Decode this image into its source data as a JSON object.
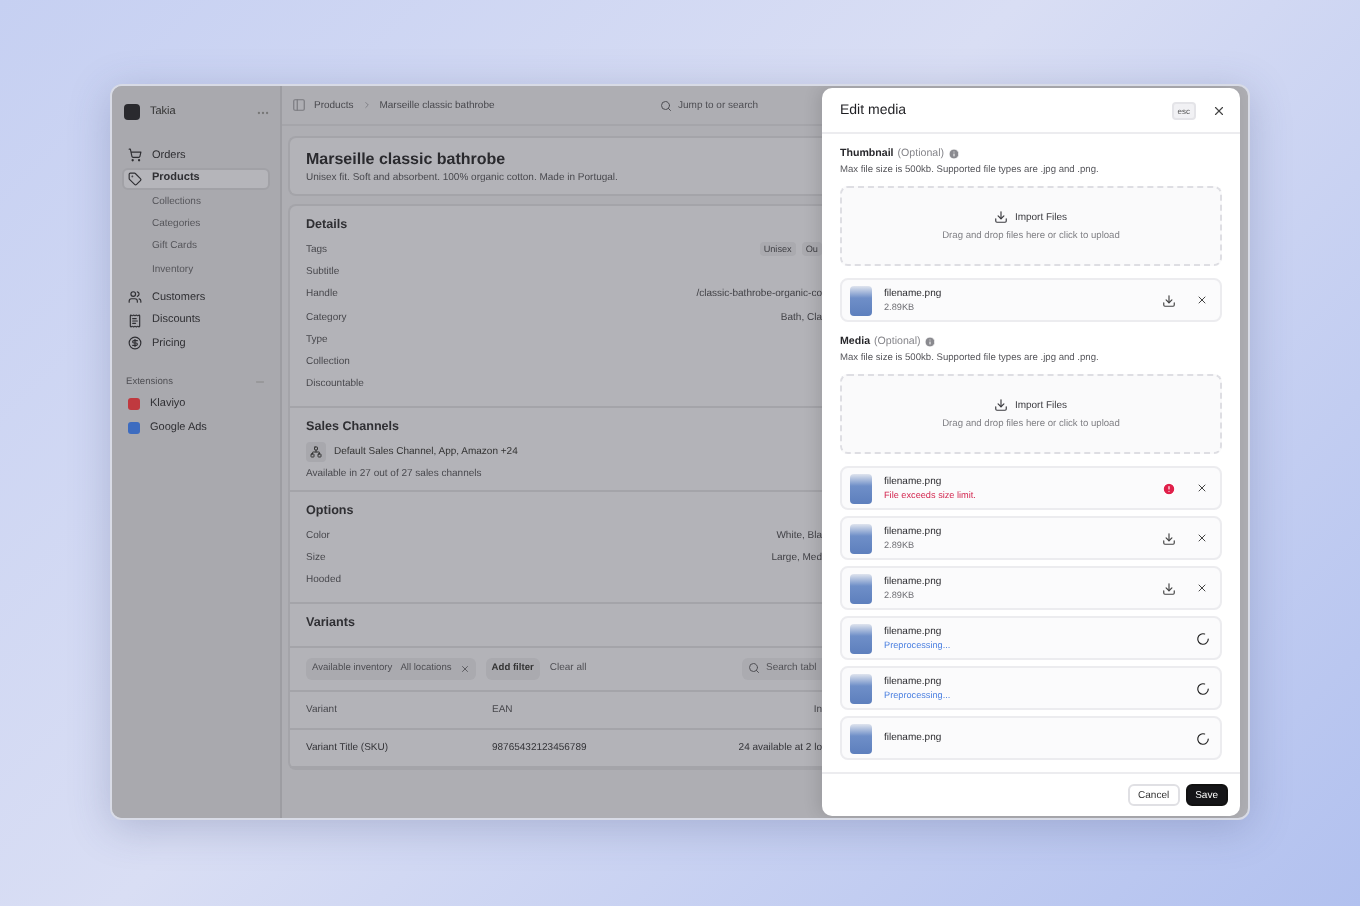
{
  "sidebar": {
    "store": "Takia",
    "items": [
      {
        "label": "Orders",
        "selected": false
      },
      {
        "label": "Products",
        "selected": true,
        "children": [
          {
            "label": "Collections"
          },
          {
            "label": "Categories"
          },
          {
            "label": "Gift Cards"
          },
          {
            "label": "Inventory"
          }
        ]
      },
      {
        "label": "Customers",
        "selected": false
      },
      {
        "label": "Discounts",
        "selected": false
      },
      {
        "label": "Pricing",
        "selected": false
      }
    ],
    "extensions_title": "Extensions",
    "extensions": [
      {
        "label": "Klaviyo",
        "color": "#c0393f"
      },
      {
        "label": "Google Ads",
        "color": "#3d6cc0"
      }
    ]
  },
  "breadcrumb": [
    "Products",
    "Marseille classic bathrobe"
  ],
  "search": {
    "placeholder": "Jump to or search"
  },
  "product": {
    "title": "Marseille classic bathrobe",
    "description": "Unisex fit. Soft and absorbent. 100% organic cotton. Made in Portugal."
  },
  "details": {
    "title": "Details",
    "rows": [
      {
        "label": "Tags",
        "tags": [
          "Unisex",
          "Ou"
        ]
      },
      {
        "label": "Subtitle",
        "value": ""
      },
      {
        "label": "Handle",
        "value": "/classic-bathrobe-organic-co"
      },
      {
        "label": "Category",
        "value": "Bath, Cla"
      },
      {
        "label": "Type"
      },
      {
        "label": "Collection"
      },
      {
        "label": "Discountable"
      }
    ]
  },
  "sales_channels": {
    "title": "Sales Channels",
    "channels": "Default Sales Channel, App, Amazon +24",
    "availability": "Available in 27 out of 27 sales channels"
  },
  "options": {
    "title": "Options",
    "rows": [
      {
        "label": "Color",
        "value": "White, Bla"
      },
      {
        "label": "Size",
        "value": "Large, Med"
      },
      {
        "label": "Hooded"
      }
    ]
  },
  "variants": {
    "title": "Variants",
    "filters": [
      {
        "label": "Available inventory",
        "value": "All locations"
      }
    ],
    "add_filter": "Add filter",
    "clear_all": "Clear all",
    "search_placeholder": "Search tabl",
    "columns": [
      "Variant",
      "EAN",
      "In"
    ],
    "rows": [
      [
        "Variant Title (SKU)",
        "98765432123456789",
        "24 available at 2 lo"
      ]
    ]
  },
  "drawer": {
    "title": "Edit media",
    "esc": "esc",
    "sections": [
      {
        "label": "Thumbnail",
        "optional": "(Optional)",
        "description": "Max file size is 500kb. Supported file types are .jpg and .png.",
        "import": "Import Files",
        "hint": "Drag and drop files here or click to upload",
        "files": [
          {
            "name": "filename.png",
            "status": "2.89KB",
            "kind": "ready"
          }
        ]
      },
      {
        "label": "Media",
        "optional": "(Optional)",
        "description": "Max file size is 500kb. Supported file types are .jpg and .png.",
        "import": "Import Files",
        "hint": "Drag and drop files here or click to upload",
        "files": [
          {
            "name": "filename.png",
            "status": "File exceeds size limit.",
            "kind": "error"
          },
          {
            "name": "filename.png",
            "status": "2.89KB",
            "kind": "ready"
          },
          {
            "name": "filename.png",
            "status": "2.89KB",
            "kind": "ready"
          },
          {
            "name": "filename.png",
            "status": "Preprocessing...",
            "kind": "processing"
          },
          {
            "name": "filename.png",
            "status": "Preprocessing...",
            "kind": "processing"
          },
          {
            "name": "filename.png",
            "kind": "processing"
          }
        ]
      }
    ],
    "buttons": {
      "cancel": "Cancel",
      "save": "Save"
    }
  }
}
